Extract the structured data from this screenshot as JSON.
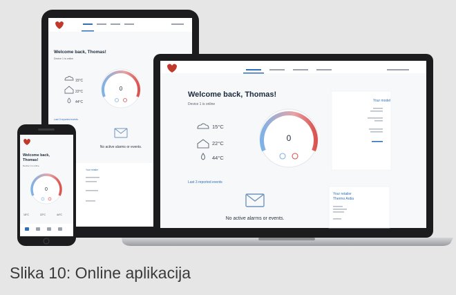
{
  "caption": "Slika 10: Online aplikacija",
  "app": {
    "welcome": "Welcome back, Thomas!",
    "welcome_line1": "Welcome back,",
    "welcome_line2": "Thomas!",
    "device_status": "Device 1 is online",
    "dial_value": "0",
    "outdoor_temp": "15°C",
    "indoor_temp": "22°C",
    "water_temp": "44°C",
    "last_events_link": "Last 3 reported events",
    "empty_state": "No active alarms or events.",
    "your_model_title": "Your model",
    "your_retailer_title": "Your retailer",
    "retailer_name": "Thermo Ardia"
  },
  "colors": {
    "accent": "#2f6fb5",
    "dial_warm": "#d9534f",
    "dial_cool": "#7fb2e5",
    "device_frame": "#1c1c1e",
    "laptop_base": "#b9bbbf"
  }
}
